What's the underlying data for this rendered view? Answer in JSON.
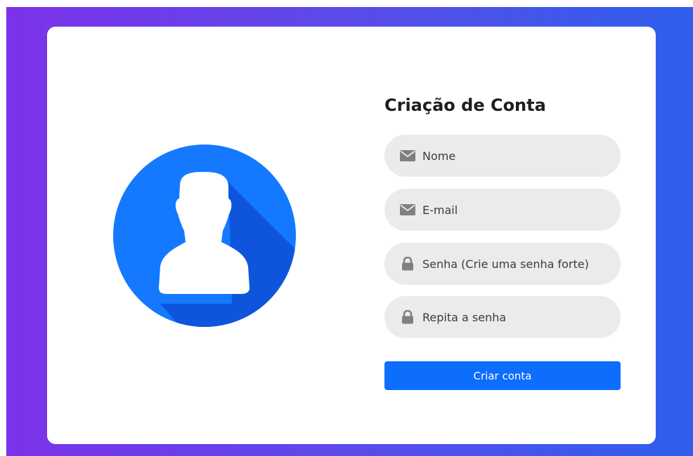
{
  "form": {
    "title": "Criação de Conta",
    "fields": [
      {
        "label": "Nome",
        "icon": "envelope-icon"
      },
      {
        "label": "E-mail",
        "icon": "envelope-icon"
      },
      {
        "label": "Senha (Crie uma senha forte)",
        "icon": "lock-icon"
      },
      {
        "label": "Repita a senha",
        "icon": "lock-icon"
      }
    ],
    "submit_label": "Criar conta"
  },
  "colors": {
    "primary": "#0d6efd",
    "avatar_blue": "#1479ff",
    "avatar_shadow": "#0f55dc",
    "field_bg": "#ebebeb",
    "gradient_start": "#7c32ea",
    "gradient_end": "#2f5fec"
  },
  "avatar": {
    "icon": "user-avatar-icon"
  }
}
